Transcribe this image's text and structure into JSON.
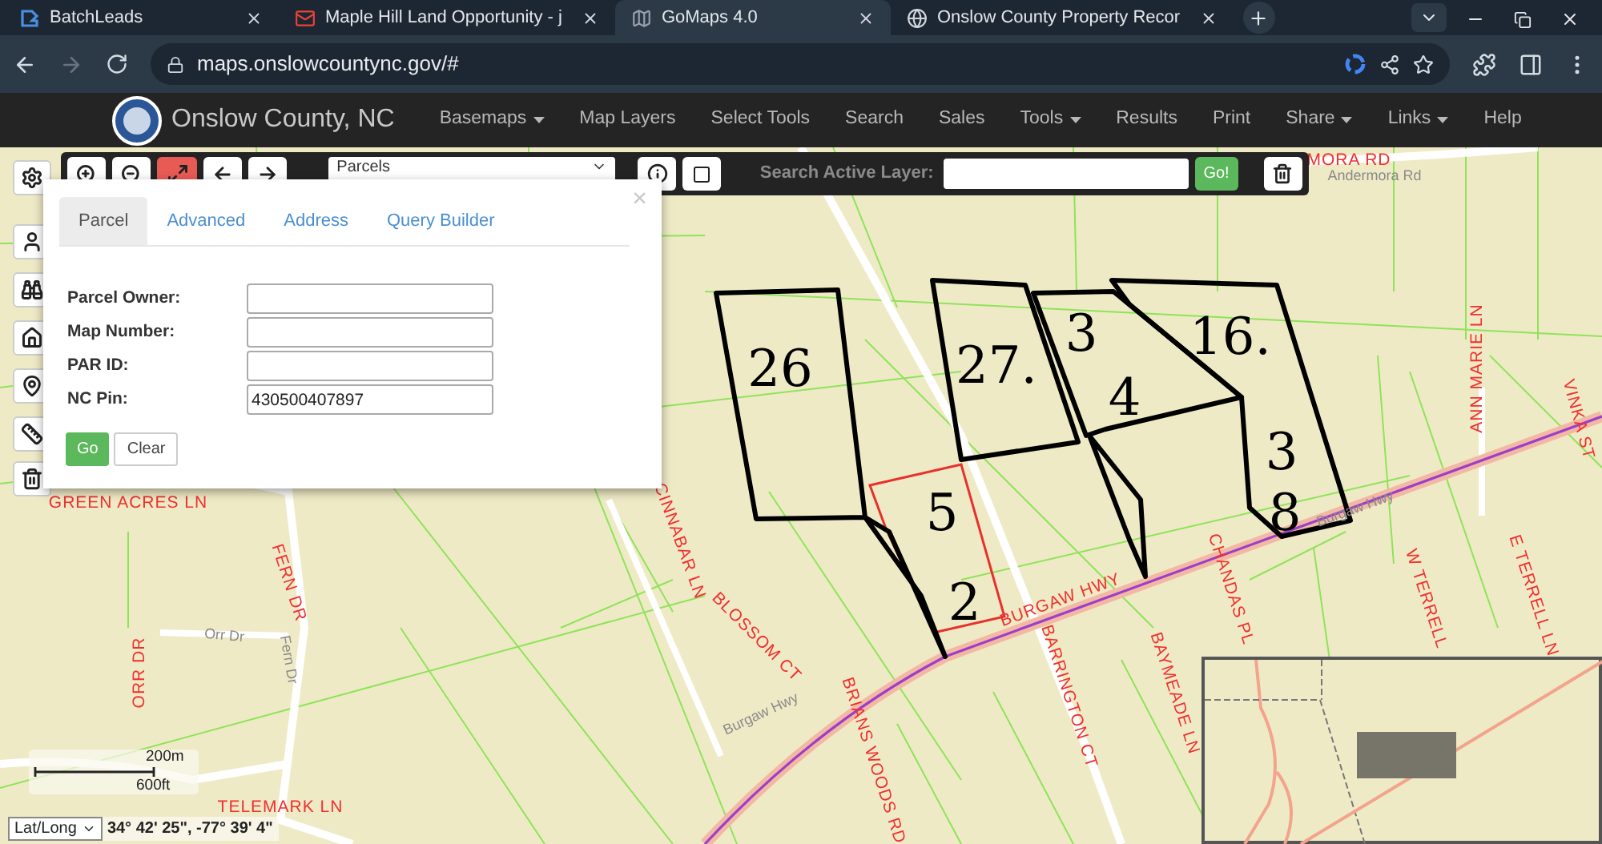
{
  "browser": {
    "tabs": [
      {
        "title": "BatchLeads",
        "selected": false
      },
      {
        "title": "Maple Hill Land Opportunity - j",
        "selected": false
      },
      {
        "title": "GoMaps 4.0",
        "selected": true
      },
      {
        "title": "Onslow County Property Recor",
        "selected": false
      }
    ],
    "url": "maps.onslowcountync.gov/#"
  },
  "navbar": {
    "title": "Onslow County, NC",
    "items": [
      {
        "label": "Basemaps",
        "dropdown": true
      },
      {
        "label": "Map Layers",
        "dropdown": false
      },
      {
        "label": "Select Tools",
        "dropdown": false
      },
      {
        "label": "Search",
        "dropdown": false
      },
      {
        "label": "Sales",
        "dropdown": false
      },
      {
        "label": "Tools",
        "dropdown": true
      },
      {
        "label": "Results",
        "dropdown": false
      },
      {
        "label": "Print",
        "dropdown": false
      },
      {
        "label": "Share",
        "dropdown": true
      },
      {
        "label": "Links",
        "dropdown": true
      },
      {
        "label": "Help",
        "dropdown": false
      }
    ]
  },
  "toolbar": {
    "tools": [
      {
        "kind": "zoom-in",
        "active": false
      },
      {
        "kind": "zoom-out",
        "active": false
      },
      {
        "kind": "full-extent",
        "active": true
      },
      {
        "kind": "back",
        "active": false
      },
      {
        "kind": "forward",
        "active": false
      }
    ],
    "layer_select": "Parcels",
    "search_label": "Search Active Layer:",
    "search_button": "Go!"
  },
  "sidebar": {
    "tools": [
      {
        "kind": "settings"
      },
      {
        "kind": "person"
      },
      {
        "kind": "binoculars"
      },
      {
        "kind": "home"
      },
      {
        "kind": "pin"
      },
      {
        "kind": "measure"
      },
      {
        "kind": "trash"
      }
    ]
  },
  "search_dialog": {
    "close": "×",
    "tabs": [
      {
        "label": "Parcel",
        "selected": true
      },
      {
        "label": "Advanced",
        "selected": false
      },
      {
        "label": "Address",
        "selected": false
      },
      {
        "label": "Query Builder",
        "selected": false
      }
    ],
    "fields": [
      {
        "label": "Parcel Owner:"
      },
      {
        "label": "Map Number:"
      },
      {
        "label": "PAR ID:"
      },
      {
        "label": "NC Pin:",
        "value": "430500407897"
      }
    ],
    "go_button": "Go",
    "clear_button": "Clear"
  },
  "map": {
    "labels": [
      {
        "text": "MORA RD",
        "kind": "street"
      },
      {
        "text": "Andermora Rd",
        "kind": "road"
      },
      {
        "text": "GREEN ACRES LN",
        "kind": "street"
      },
      {
        "text": "ANN MARIE LN",
        "kind": "street"
      },
      {
        "text": "VINKA ST",
        "kind": "street"
      },
      {
        "text": "CINNABAR LN",
        "kind": "street"
      },
      {
        "text": "FERN DR",
        "kind": "street"
      },
      {
        "text": "BLOSSOM CT",
        "kind": "street"
      },
      {
        "text": "ORR DR",
        "kind": "street"
      },
      {
        "text": "Orr Dr",
        "kind": "road"
      },
      {
        "text": "Fern Dr",
        "kind": "road"
      },
      {
        "text": "BURGAW HWY",
        "kind": "street"
      },
      {
        "text": "Burgaw Hwy",
        "kind": "road"
      },
      {
        "text": "CHANDAS PL",
        "kind": "street"
      },
      {
        "text": "W TERRELL",
        "kind": "street"
      },
      {
        "text": "E TERRELL LN",
        "kind": "street"
      },
      {
        "text": "Burgaw Hwy",
        "kind": "road"
      },
      {
        "text": "BARRINGTON CT",
        "kind": "street"
      },
      {
        "text": "BAYMEADE LN",
        "kind": "street"
      },
      {
        "text": "BRIANS WOODS RD",
        "kind": "street"
      },
      {
        "text": "TELEMARK LN",
        "kind": "street"
      }
    ],
    "annotations": [
      {
        "text": "26"
      },
      {
        "text": "27."
      },
      {
        "text": "3"
      },
      {
        "text": "4"
      },
      {
        "text": "16."
      },
      {
        "text": "3"
      },
      {
        "text": "8"
      },
      {
        "text": "5"
      },
      {
        "text": "2"
      }
    ],
    "scale": {
      "metric": "200m",
      "imperial": "600ft"
    },
    "coordinates": {
      "format": "Lat/Long",
      "value": "34° 42' 25\", -77° 39' 4\""
    }
  }
}
